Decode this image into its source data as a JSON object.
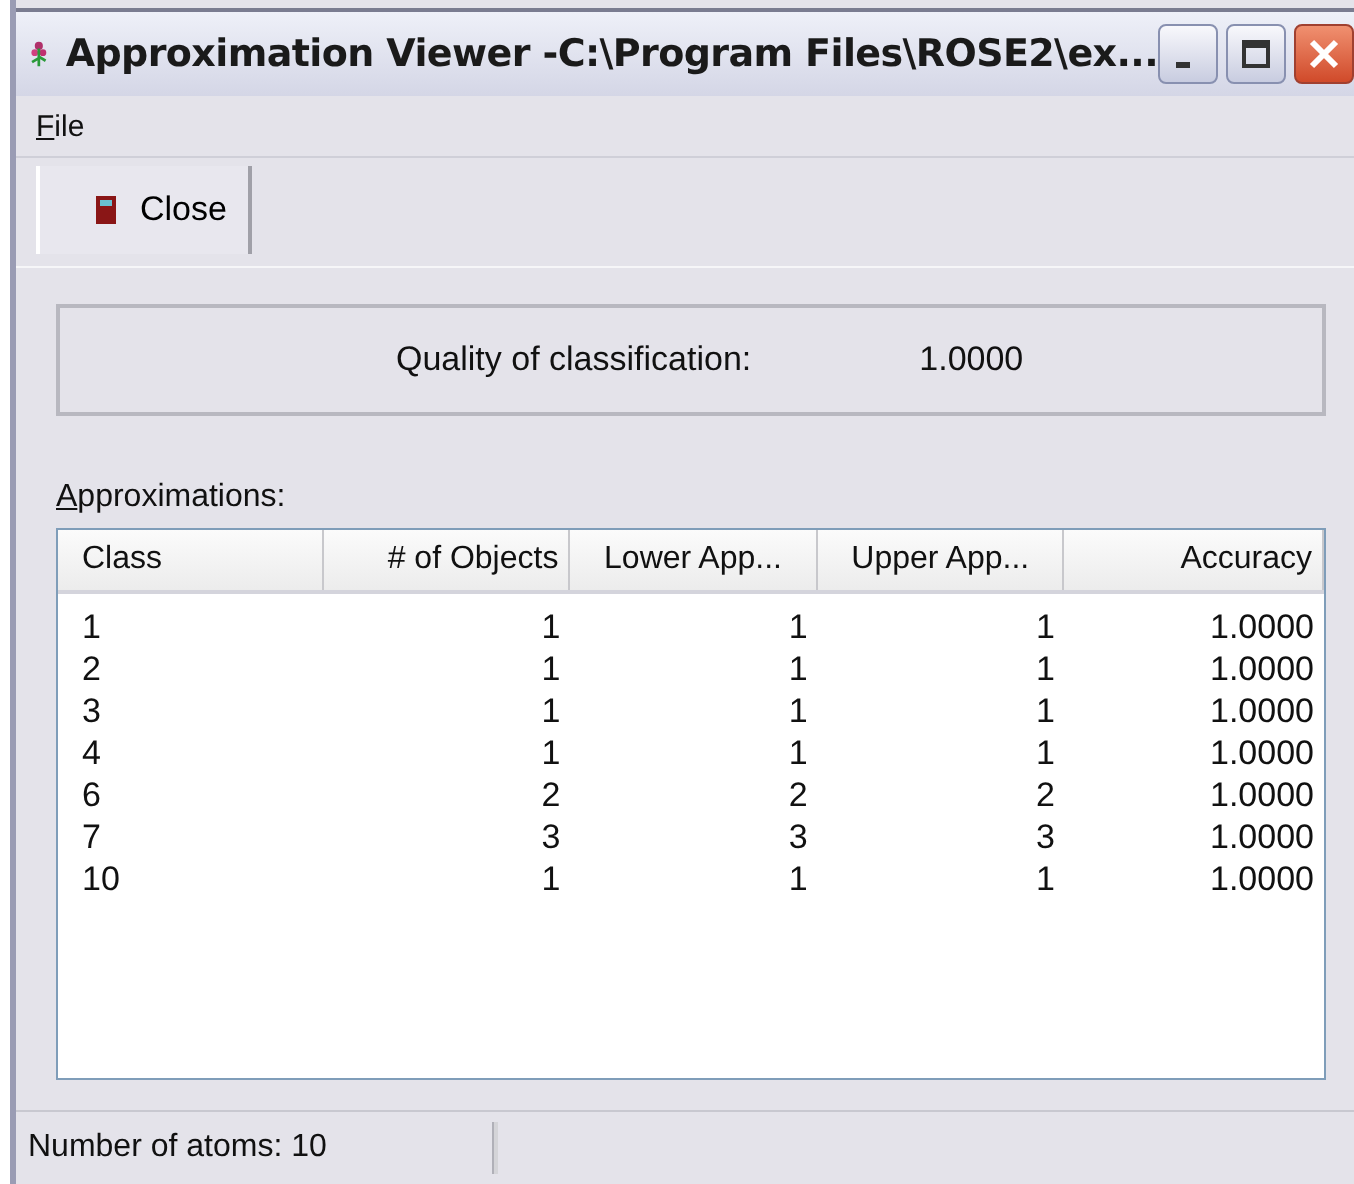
{
  "window": {
    "title": "Approximation Viewer -C:\\Program Files\\ROSE2\\ex..."
  },
  "menu": [
    "File"
  ],
  "toolbar": [
    {
      "label": "Close"
    }
  ],
  "quality": {
    "label": "Quality of classification:",
    "value": "1.0000"
  },
  "approximations": {
    "label": "Approximations:",
    "columns": [
      "Class",
      "# of Objects",
      "Lower App...",
      "Upper App...",
      "Accuracy"
    ],
    "rows": [
      [
        "1",
        "1",
        "1",
        "1",
        "1.0000"
      ],
      [
        "2",
        "1",
        "1",
        "1",
        "1.0000"
      ],
      [
        "3",
        "1",
        "1",
        "1",
        "1.0000"
      ],
      [
        "4",
        "1",
        "1",
        "1",
        "1.0000"
      ],
      [
        "6",
        "2",
        "2",
        "2",
        "1.0000"
      ],
      [
        "7",
        "3",
        "3",
        "3",
        "1.0000"
      ],
      [
        "10",
        "1",
        "1",
        "1",
        "1.0000"
      ]
    ]
  },
  "status_bar": "Number of atoms: 10"
}
